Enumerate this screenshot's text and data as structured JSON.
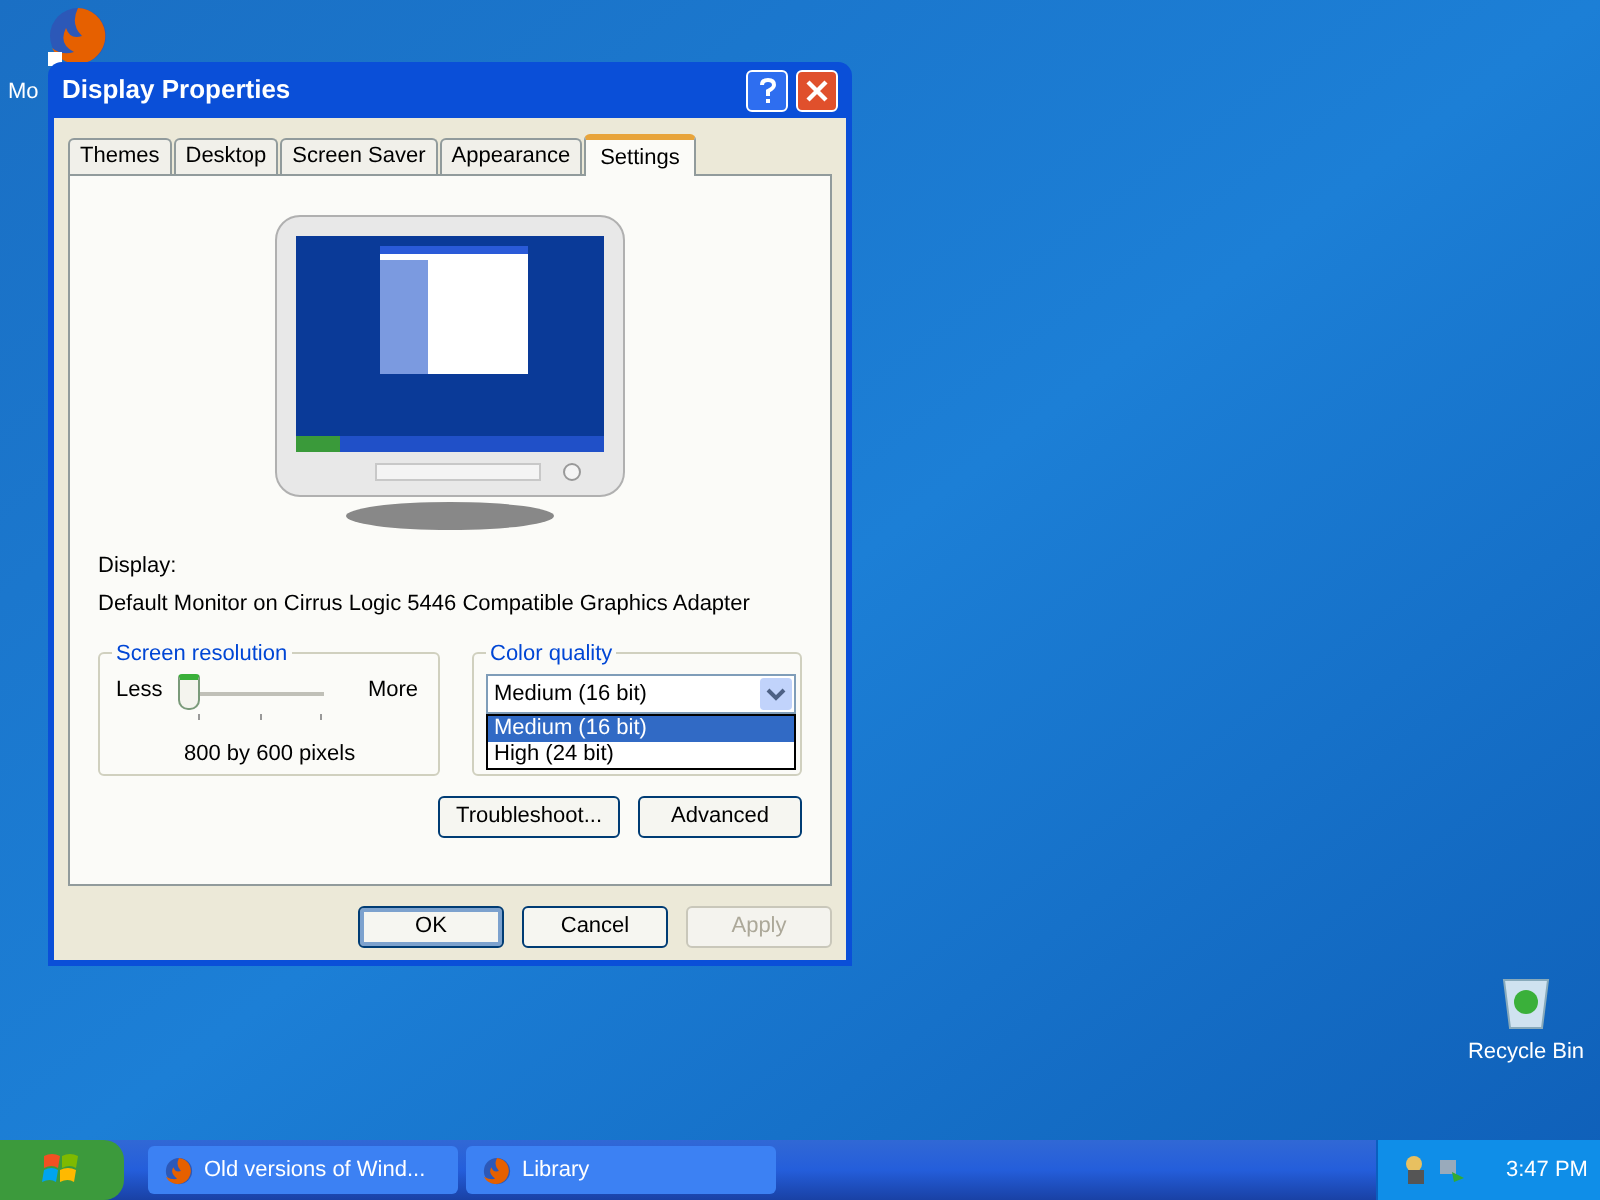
{
  "desktop_icons": [
    {
      "kind": "firefox",
      "label": "Mo"
    },
    {
      "kind": "recycle_bin",
      "label": "Recycle Bin"
    }
  ],
  "window": {
    "title": "Display Properties",
    "tabs": [
      {
        "label": "Themes",
        "selected": false
      },
      {
        "label": "Desktop",
        "selected": false
      },
      {
        "label": "Screen Saver",
        "selected": false
      },
      {
        "label": "Appearance",
        "selected": false
      },
      {
        "label": "Settings",
        "selected": true
      }
    ],
    "display_label": "Display:",
    "display_value": "Default Monitor on Cirrus Logic 5446 Compatible Graphics Adapter",
    "resolution": {
      "legend": "Screen resolution",
      "min_label": "Less",
      "max_label": "More",
      "level": 0,
      "reading": "800 by 600 pixels"
    },
    "color_quality": {
      "legend": "Color quality",
      "value": "Medium (16 bit)",
      "expanded": true,
      "options": [
        {
          "label": "Medium (16 bit)",
          "selected": true
        },
        {
          "label": "High (24 bit)",
          "selected": false
        }
      ]
    },
    "buttons": [
      {
        "label": "Troubleshoot..."
      },
      {
        "label": "Advanced"
      }
    ],
    "footer_buttons": [
      {
        "label": "OK",
        "default": true,
        "disabled": false
      },
      {
        "label": "Cancel",
        "default": false,
        "disabled": false
      },
      {
        "label": "Apply",
        "default": false,
        "disabled": true
      }
    ]
  },
  "taskbar": {
    "items": [
      {
        "label": "Old versions of Wind..."
      },
      {
        "label": "Library"
      }
    ],
    "clock": "3:47 PM"
  }
}
